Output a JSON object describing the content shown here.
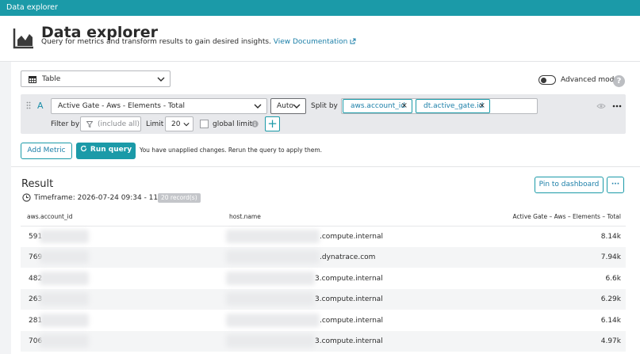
{
  "topbar": {
    "title": "Data explorer"
  },
  "header": {
    "title": "Data explorer",
    "subtitle": "Query for metrics and transform results to gain desired insights.",
    "doc_link": "View Documentation"
  },
  "visualization": {
    "selected": "Table",
    "icon": "table-icon"
  },
  "advanced_mode": {
    "label": "Advanced mode",
    "enabled": true,
    "help": "?"
  },
  "query": {
    "letter": "A",
    "metric": "Active Gate - Aws - Elements - Total",
    "aggregation": "Auto",
    "split_by_label": "Split by",
    "split_by": [
      {
        "label": "aws.account_id",
        "remove": "×"
      },
      {
        "label": "dt.active_gate.id",
        "remove": "×"
      }
    ],
    "filter_label": "Filter by",
    "filter_placeholder": "(include all)",
    "limit_label": "Limit",
    "limit_value": "20",
    "global_limit_label": "global limit",
    "add_filter": "+"
  },
  "actions": {
    "add_metric": "Add Metric",
    "run_query": "Run query",
    "notice": "You have unapplied changes. Rerun the query to apply them."
  },
  "result": {
    "title": "Result",
    "timeframe": "Timeframe: 2026-07-24 09:34 - 11:34",
    "records": "20 record(s)",
    "pin": "Pin to dashboard",
    "more": "···",
    "columns": [
      "aws.account_id",
      "host.name",
      "Active Gate – Aws – Elements – Total"
    ],
    "rows": [
      {
        "account": "591",
        "host": ".compute.internal",
        "value": "8.14k"
      },
      {
        "account": "769",
        "host": ".dynatrace.com",
        "value": "7.94k"
      },
      {
        "account": "482",
        "host": "3.compute.internal",
        "value": "6.6k"
      },
      {
        "account": "263",
        "host": "3.compute.internal",
        "value": "6.29k"
      },
      {
        "account": "281",
        "host": ".compute.internal",
        "value": "6.14k"
      },
      {
        "account": "706",
        "host": "3.compute.internal",
        "value": "4.97k"
      }
    ]
  },
  "colors": {
    "accent": "#1b9aa8",
    "link": "#1b7fa8"
  }
}
